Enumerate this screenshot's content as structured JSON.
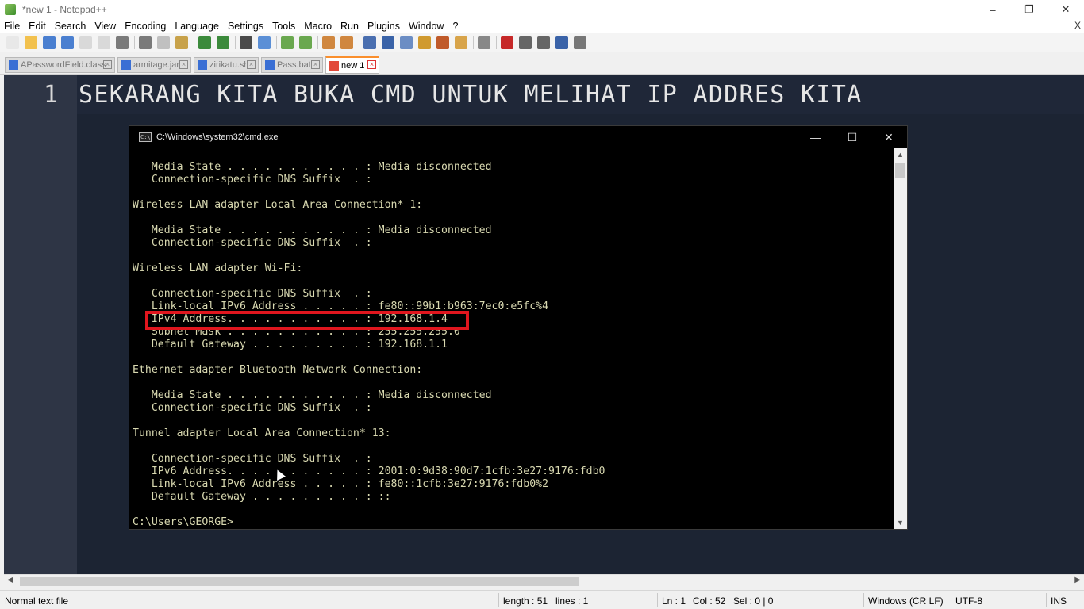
{
  "window": {
    "title": "*new 1 - Notepad++",
    "controls": [
      "–",
      "❐",
      "✕"
    ]
  },
  "menu": [
    "File",
    "Edit",
    "Search",
    "View",
    "Encoding",
    "Language",
    "Settings",
    "Tools",
    "Macro",
    "Run",
    "Plugins",
    "Window",
    "?"
  ],
  "menu_close": "X",
  "tabs": [
    {
      "label": "APasswordField.class",
      "active": false
    },
    {
      "label": "armitage.jar",
      "active": false
    },
    {
      "label": "zirikatu.sh",
      "active": false
    },
    {
      "label": "Pass.bat",
      "active": false
    },
    {
      "label": "new 1",
      "active": true
    }
  ],
  "editor": {
    "line_number": "1",
    "line_text": "SEKARANG KITA BUKA CMD UNTUK MELIHAT IP ADDRES KITA"
  },
  "cmd": {
    "title": "C:\\Windows\\system32\\cmd.exe",
    "icon_text": "C:\\",
    "controls": [
      "—",
      "☐",
      "✕"
    ],
    "lines": [
      "   Media State . . . . . . . . . . . : Media disconnected",
      "   Connection-specific DNS Suffix  . :",
      "",
      "Wireless LAN adapter Local Area Connection* 1:",
      "",
      "   Media State . . . . . . . . . . . : Media disconnected",
      "   Connection-specific DNS Suffix  . :",
      "",
      "Wireless LAN adapter Wi-Fi:",
      "",
      "   Connection-specific DNS Suffix  . :",
      "   Link-local IPv6 Address . . . . . : fe80::99b1:b963:7ec0:e5fc%4",
      "   IPv4 Address. . . . . . . . . . . : 192.168.1.4",
      "   Subnet Mask . . . . . . . . . . . : 255.255.255.0",
      "   Default Gateway . . . . . . . . . : 192.168.1.1",
      "",
      "Ethernet adapter Bluetooth Network Connection:",
      "",
      "   Media State . . . . . . . . . . . : Media disconnected",
      "   Connection-specific DNS Suffix  . :",
      "",
      "Tunnel adapter Local Area Connection* 13:",
      "",
      "   Connection-specific DNS Suffix  . :",
      "   IPv6 Address. . . . . . . . . . . : 2001:0:9d38:90d7:1cfb:3e27:9176:fdb0",
      "   Link-local IPv6 Address . . . . . : fe80::1cfb:3e27:9176:fdb0%2",
      "   Default Gateway . . . . . . . . . : ::",
      "",
      "C:\\Users\\GEORGE>"
    ]
  },
  "statusbar": {
    "file_type": "Normal text file",
    "length": "length : 51",
    "lines": "lines : 1",
    "ln": "Ln : 1",
    "col": "Col : 52",
    "sel": "Sel : 0 | 0",
    "eol": "Windows (CR LF)",
    "encoding": "UTF-8",
    "mode": "INS"
  },
  "toolbar_icons": [
    "new-file-icon",
    "open-file-icon",
    "save-icon",
    "save-all-icon",
    "close-icon",
    "close-all-icon",
    "print-icon",
    "cut-icon",
    "copy-icon",
    "paste-icon",
    "undo-icon",
    "redo-icon",
    "find-icon",
    "replace-icon",
    "zoom-in-icon",
    "zoom-out-icon",
    "sync-v-icon",
    "sync-h-icon",
    "word-wrap-icon",
    "show-all-chars-icon",
    "indent-guide-icon",
    "doc-map-icon",
    "function-list-icon",
    "folder-workspace-icon",
    "monitor-icon",
    "record-macro-icon",
    "stop-record-icon",
    "play-macro-icon",
    "run-macro-multiple-icon",
    "save-macro-icon"
  ],
  "colors": {
    "editor_bg": "#1c2433",
    "gutter_bg": "#2e3545",
    "cmd_text": "#d8d8b0",
    "highlight": "#e0161e",
    "active_tab_accent": "#fa8f2d"
  }
}
